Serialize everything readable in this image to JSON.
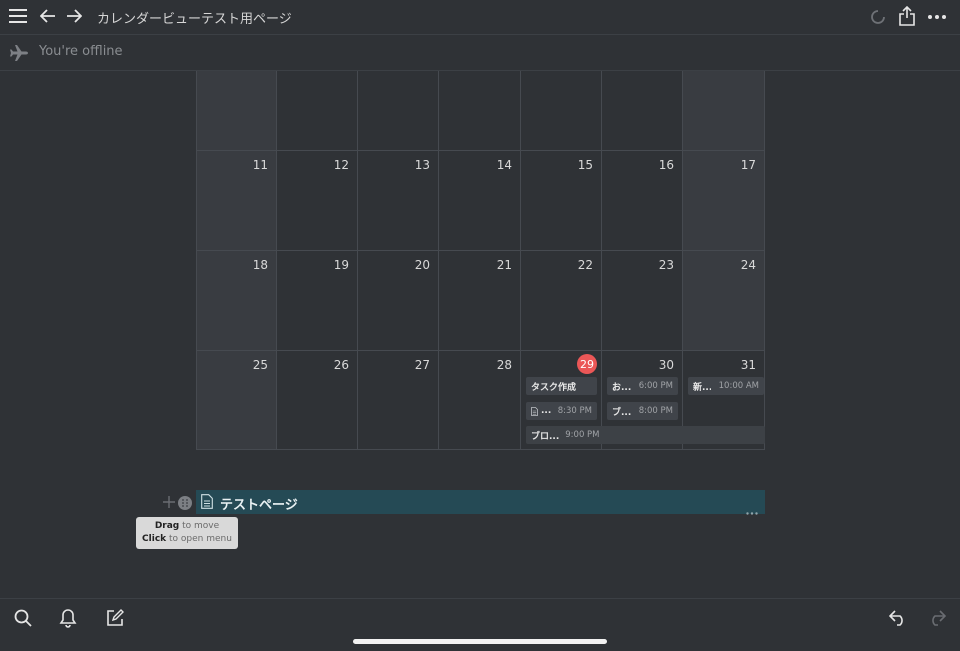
{
  "header": {
    "title": "カレンダービューテスト用ページ",
    "menu_icon": "hamburger-menu-icon",
    "back_icon": "arrow-left-icon",
    "forward_icon": "arrow-right-icon",
    "loading_icon": "spinner-icon",
    "share_icon": "share-icon",
    "more_icon": "more-horizontal-icon"
  },
  "offline": {
    "text": "You're offline",
    "icon": "airplane-icon"
  },
  "calendar": {
    "rows": [
      [
        "",
        "",
        "",
        "",
        "",
        "",
        ""
      ],
      [
        "11",
        "12",
        "13",
        "14",
        "15",
        "16",
        "17"
      ],
      [
        "18",
        "19",
        "20",
        "21",
        "22",
        "23",
        "24"
      ],
      [
        "25",
        "26",
        "27",
        "28",
        "29",
        "30",
        "31"
      ]
    ],
    "today": "29",
    "events": {
      "e1": {
        "title": "タスク作成",
        "time": ""
      },
      "e2": {
        "title": "...",
        "time": "8:30 PM",
        "icon": "page-icon"
      },
      "e3": {
        "title": "お...",
        "time": "6:00 PM"
      },
      "e4": {
        "title": "ブ...",
        "time": "8:00 PM"
      },
      "e5": {
        "title": "新...",
        "time": "10:00 AM"
      },
      "e6": {
        "title": "ブロ...",
        "time": "9:00 PM"
      }
    }
  },
  "page_block": {
    "title": "テストページ",
    "add_icon": "plus-icon",
    "drag_icon": "drag-handle-icon",
    "page_icon": "page-icon",
    "more_icon": "more-horizontal-icon"
  },
  "tooltip": {
    "line1_strong": "Drag",
    "line1_rest": " to move",
    "line2_strong": "Click",
    "line2_rest": " to open menu"
  },
  "bottom": {
    "search_icon": "search-icon",
    "bell_icon": "bell-icon",
    "compose_icon": "compose-icon",
    "undo_icon": "undo-icon",
    "redo_icon": "redo-icon"
  },
  "colors": {
    "background": "#2f3236",
    "weekend_cell": "#393c41",
    "today_badge": "#eb5757",
    "selected_block": "#254a55"
  }
}
